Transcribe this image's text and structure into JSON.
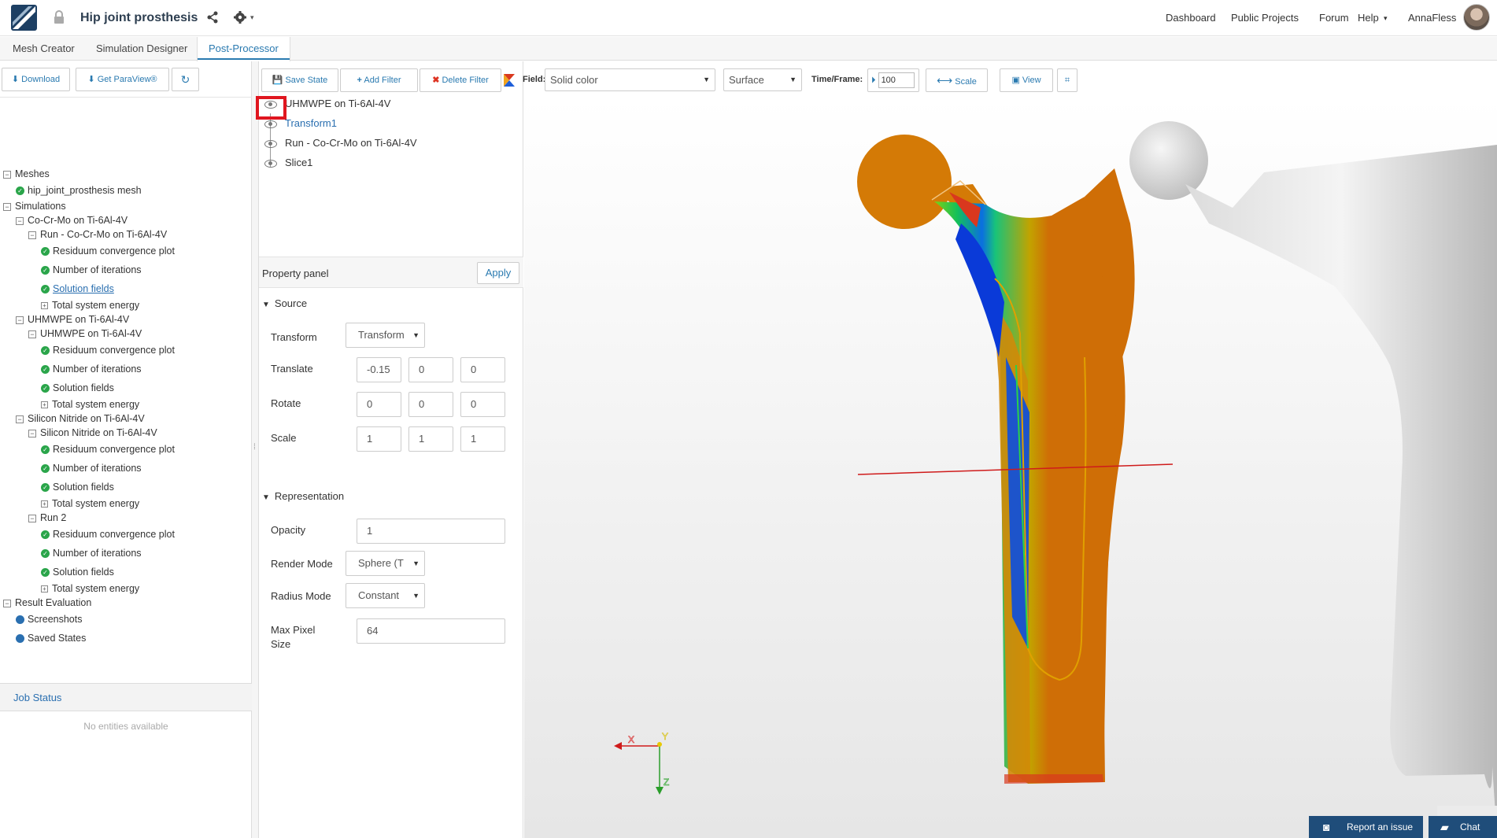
{
  "header": {
    "project_title": "Hip joint prosthesis",
    "nav": [
      "Dashboard",
      "Public Projects",
      "Forum",
      "Help"
    ],
    "user": "AnnaFless"
  },
  "tabs": [
    "Mesh Creator",
    "Simulation Designer",
    "Post-Processor"
  ],
  "left_toolbar": {
    "download": "Download",
    "get_paraview": "Get ParaView®"
  },
  "tree": {
    "meshes": "Meshes",
    "mesh_item": "hip_joint_prosthesis mesh",
    "simulations": "Simulations",
    "sim1": "Co-Cr-Mo on Ti-6Al-4V",
    "sim1_run": "Run - Co-Cr-Mo on Ti-6Al-4V",
    "sim2": "UHMWPE on Ti-6Al-4V",
    "sim2_run": "UHMWPE on Ti-6Al-4V",
    "sim3": "Silicon Nitride on Ti-6Al-4V",
    "sim3_run": "Silicon Nitride on Ti-6Al-4V",
    "run2": "Run 2",
    "residuum": "Residuum convergence plot",
    "iterations": "Number of iterations",
    "solution_fields": "Solution fields",
    "total_energy": "Total system energy",
    "result_evaluation": "Result Evaluation",
    "screenshots": "Screenshots",
    "saved_states": "Saved States"
  },
  "job_status": {
    "title": "Job Status",
    "empty": "No entities available"
  },
  "pipeline": {
    "items": [
      "UHMWPE on Ti-6Al-4V",
      "Transform1",
      "Run - Co-Cr-Mo on Ti-6Al-4V",
      "Slice1"
    ]
  },
  "viewer_toolbar": {
    "save_state": "Save State",
    "add_filter": "Add Filter",
    "delete_filter": "Delete Filter",
    "field_label": "Field:",
    "field_value": "Solid color",
    "representation_value": "Surface",
    "time_label": "Time/Frame:",
    "time_value": "100",
    "scale": "Scale",
    "view": "View"
  },
  "property_panel": {
    "title": "Property panel",
    "apply": "Apply",
    "source_section": "Source",
    "transform_label": "Transform",
    "transform_value": "Transform",
    "translate_label": "Translate",
    "translate": [
      "-0.15",
      "0",
      "0"
    ],
    "rotate_label": "Rotate",
    "rotate": [
      "0",
      "0",
      "0"
    ],
    "scale_label": "Scale",
    "scale": [
      "1",
      "1",
      "1"
    ],
    "representation_section": "Representation",
    "opacity_label": "Opacity",
    "opacity": "1",
    "render_mode_label": "Render Mode",
    "render_mode": "Sphere (T",
    "radius_mode_label": "Radius Mode",
    "radius_mode": "Constant",
    "max_pixel_label_1": "Max Pixel",
    "max_pixel_label_2": "Size",
    "max_pixel": "64"
  },
  "axes": {
    "x": "X",
    "y": "Y",
    "z": "Z"
  },
  "footer": {
    "report": "Report an issue",
    "chat": "Chat"
  },
  "colors": {
    "accent": "#2a7ab0",
    "highlight": "#e0161f",
    "footer_button": "#1f4d7a"
  }
}
